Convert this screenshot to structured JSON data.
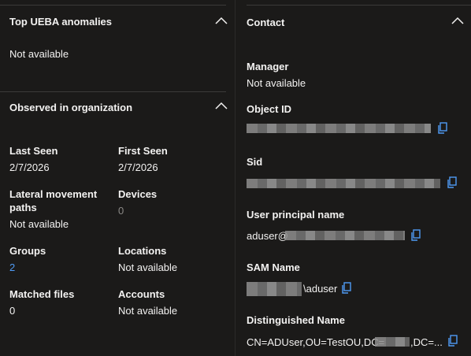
{
  "ueba": {
    "title": "Top UEBA anomalies",
    "value": "Not available"
  },
  "observed": {
    "title": "Observed in organization",
    "fields": {
      "last_seen": {
        "label": "Last Seen",
        "value": "2/7/2026"
      },
      "first_seen": {
        "label": "First Seen",
        "value": "2/7/2026"
      },
      "lateral_line1": "Lateral movement",
      "lateral_line2": "paths",
      "lateral_value": "Not available",
      "devices": {
        "label": "Devices",
        "value": "0"
      },
      "groups": {
        "label": "Groups",
        "value": "2"
      },
      "locations": {
        "label": "Locations",
        "value": "Not available"
      },
      "matched_files": {
        "label": "Matched files",
        "value": "0"
      },
      "accounts": {
        "label": "Accounts",
        "value": "Not available"
      }
    }
  },
  "contact": {
    "title": "Contact",
    "manager": {
      "label": "Manager",
      "value": "Not available"
    },
    "object_id": {
      "label": "Object ID"
    },
    "sid": {
      "label": "Sid"
    },
    "upn": {
      "label": "User principal name",
      "value_prefix": "aduser@"
    },
    "sam": {
      "label": "SAM Name",
      "value_suffix": "\\aduser"
    },
    "dn": {
      "label": "Distinguished Name",
      "value_prefix": "CN=ADUser,OU=TestOU,DC=",
      "value_suffix": ",DC=..."
    }
  },
  "colors": {
    "background": "#1b1a19",
    "link": "#4f9bf5",
    "muted": "#8a8886"
  }
}
